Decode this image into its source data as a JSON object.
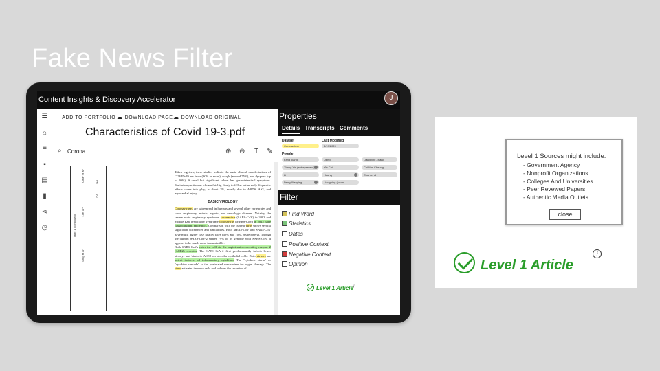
{
  "slide": {
    "title": "Fake News Filter"
  },
  "app": {
    "header_title": "Content Insights & Discovery Accelerator",
    "avatar_initial": "J"
  },
  "toolbar": {
    "add_to_portfolio": "ADD TO PORTFOLIO",
    "download_page": "DOWNLOAD PAGE",
    "download_original": "DOWNLOAD ORIGINAL"
  },
  "document": {
    "title": "Characteristics of Covid 19-3.pdf",
    "search_value": "Corona",
    "section_heading": "BASIC VIROLOGY",
    "intro_text": "Taken together, these studies indicate the main clinical manifestations of COVID-19 are fever (90% or more), cough (around 75%), and dyspnea (up to 50%). A small but significant subset has gastrointestinal symptoms. Preliminary estimates of case fatality, likely to fall as better early diagnostic efforts come into play, is about 2%, mostly due to ARDS, AKI, and myocardial injury.",
    "para1_a": "Coronaviruses",
    "para1_b": " are widespread in humans and several other vertebrates and cause respiratory, enteric, hepatic, and neurologic diseases. Notably, the severe acute respiratory syndrome ",
    "para1_c": "coronavirus",
    "para1_d": " (SARS-CoV) in 2003 and Middle East respiratory syndrome ",
    "para1_e": "coronavirus",
    "para1_f": " (MERS-CoV) ",
    "para1_g": "in 2012 have caused human epidemics.",
    "para1_h": " Comparison with the current ",
    "para1_i": "virus",
    "para1_j": " shows several significant differences and similarities. Both MERS-CoV and SARS-CoV have much higher case fatality rates (40% and 10%, respectively). Though the current SARS-CoV-2 shares 79% of its genome with SARS-CoV, it appears to be much more transmissible.",
    "para2_a": "Both SARS-CoVs ",
    "para2_b": "enter the cell via the angiotensin-converting enzyme 2 (ACE2) receptor.",
    "para2_c": " The SARS-CoV-2 first predominantly infects lower airways and binds to ACE2 on alveolar epithelial cells. Both ",
    "para2_d": "viruses",
    "para2_e": " are ",
    "para2_f": "potent inducers of inflammatory cytokines.",
    "para2_g": " The \"cytokine storm\" or \"cytokine cascade\" is the postulated mechanism for organ damage. The ",
    "para2_h": "virus",
    "para2_i": " activates immune cells and induces the secretion of",
    "table_col1": "Table 1 (continued)",
    "table_col2": "Clear et al⁵",
    "table_col3": "Li et al⁴",
    "table_col4": "Song et al⁹",
    "table_col5": "NA",
    "table_col6": "NA"
  },
  "properties": {
    "title": "Properties",
    "tabs": [
      "Details",
      "Transcripts",
      "Comments"
    ],
    "dataset_label": "Dataset",
    "dataset_value": "Coronavirus",
    "modified_label": "Last Modified",
    "modified_value": "3/19/2020",
    "people_label": "People",
    "people": [
      "Fang Jiang",
      "Deng",
      "Liangping Zhang",
      "Zhang Yin (entrepreneur)",
      "Yin Cai",
      "Chi Wai Cheung",
      "Li",
      "Huang",
      "Chan et al",
      "Deng Xiaoping",
      "Liangping (room)"
    ]
  },
  "filter": {
    "title": "Filter",
    "items": [
      "Find Word",
      "Statistics",
      "Dates",
      "Positive Context",
      "Negative Context",
      "Opinion"
    ],
    "badge": "Level 1 Article"
  },
  "callout": {
    "popup_title": "Level 1 Sources might include:",
    "sources": [
      "- Government Agency",
      "- Nonprofit Organizations",
      "- Colleges And Universities",
      "- Peer Revewed Papers",
      "- Authentic Media Outlets"
    ],
    "close_label": "close",
    "badge": "Level 1 Article",
    "info_glyph": "i"
  },
  "colors": {
    "accent_green": "#2a9d2a",
    "highlight_yellow": "#fff08a",
    "highlight_green": "#b6f0a2",
    "header_black": "#0d0d0d"
  },
  "icons": [
    "hamburger-icon",
    "home-icon",
    "database-icon",
    "save-icon",
    "library-icon",
    "chart-icon",
    "share-icon",
    "history-icon",
    "plus-icon",
    "cloud-download-icon",
    "search-icon",
    "zoom-in-icon",
    "zoom-out-icon",
    "text-icon",
    "wrench-icon",
    "check-circle-icon",
    "info-icon"
  ]
}
